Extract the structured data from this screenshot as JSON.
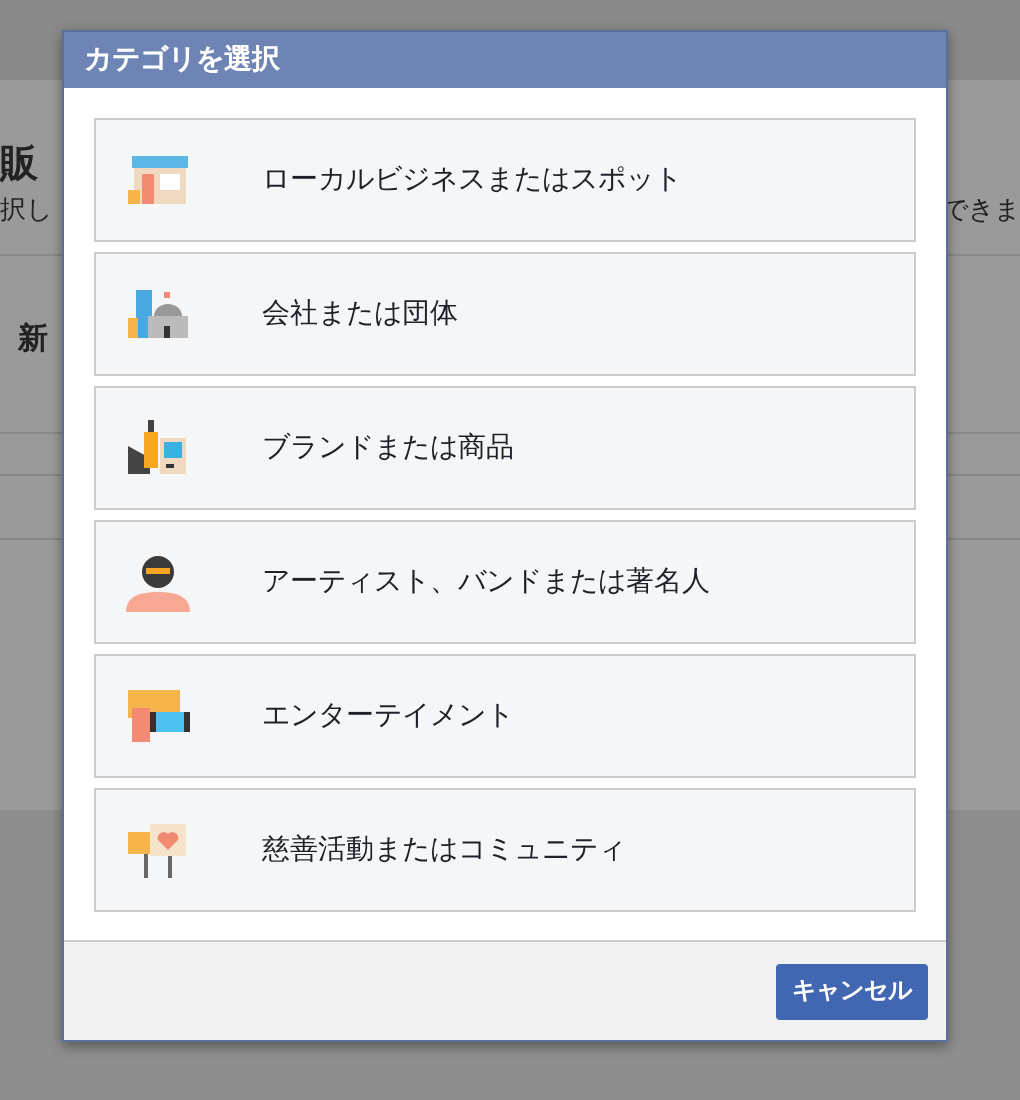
{
  "background_page": {
    "heading": "販",
    "description_left": "択し",
    "description_right": "できま",
    "section_heading": "新"
  },
  "dialog": {
    "title": "カテゴリを選択",
    "categories": [
      {
        "kind": "store",
        "label": "ローカルビジネスまたはスポット"
      },
      {
        "kind": "company",
        "label": "会社または団体"
      },
      {
        "kind": "brand",
        "label": "ブランドまたは商品"
      },
      {
        "kind": "artist",
        "label": "アーティスト、バンドまたは著名人"
      },
      {
        "kind": "entertainment",
        "label": "エンターテイメント"
      },
      {
        "kind": "community",
        "label": "慈善活動またはコミュニティ"
      }
    ],
    "buttons": [
      {
        "label": "キャンセル"
      }
    ]
  }
}
